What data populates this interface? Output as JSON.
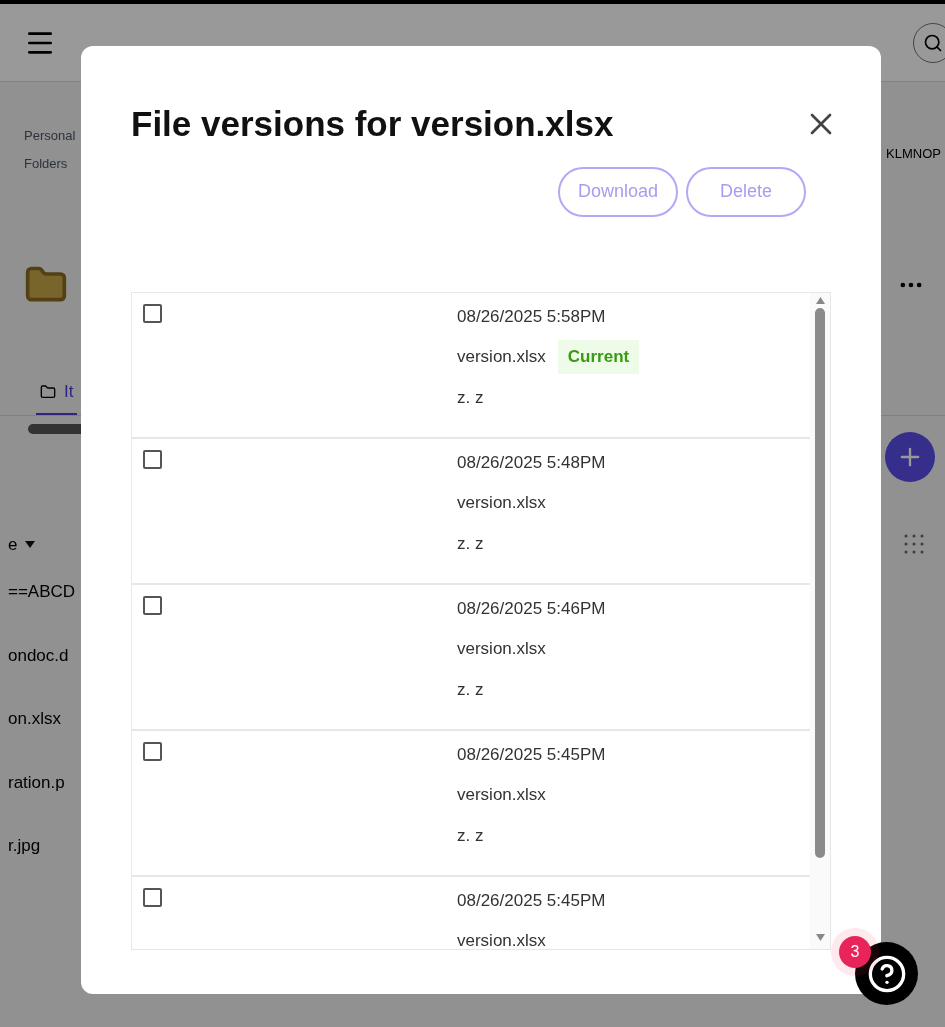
{
  "background": {
    "breadcrumb": [
      "Personal",
      "Folders"
    ],
    "breadcrumb_right": "KLMNOP",
    "tab": {
      "label": "It",
      "selected": true
    },
    "sort_label": "e",
    "files": [
      "==ABCD",
      "ondoc.d",
      "on.xlsx",
      "ration.p",
      "r.jpg"
    ]
  },
  "dialog": {
    "title": "File versions for version.xlsx",
    "actions": [
      {
        "label": "Download",
        "disabled": true
      },
      {
        "label": "Delete",
        "disabled": true
      }
    ],
    "versions": [
      {
        "checked": false,
        "date": "08/26/2025 5:58PM",
        "name": "version.xlsx",
        "current": true,
        "current_label": "Current",
        "author": "z. z"
      },
      {
        "checked": false,
        "date": "08/26/2025 5:48PM",
        "name": "version.xlsx",
        "current": false,
        "author": "z. z"
      },
      {
        "checked": false,
        "date": "08/26/2025 5:46PM",
        "name": "version.xlsx",
        "current": false,
        "author": "z. z"
      },
      {
        "checked": false,
        "date": "08/26/2025 5:45PM",
        "name": "version.xlsx",
        "current": false,
        "author": "z. z"
      },
      {
        "checked": false,
        "date": "08/26/2025 5:45PM",
        "name": "version.xlsx",
        "current": false
      }
    ]
  },
  "help": {
    "badge": "3"
  }
}
